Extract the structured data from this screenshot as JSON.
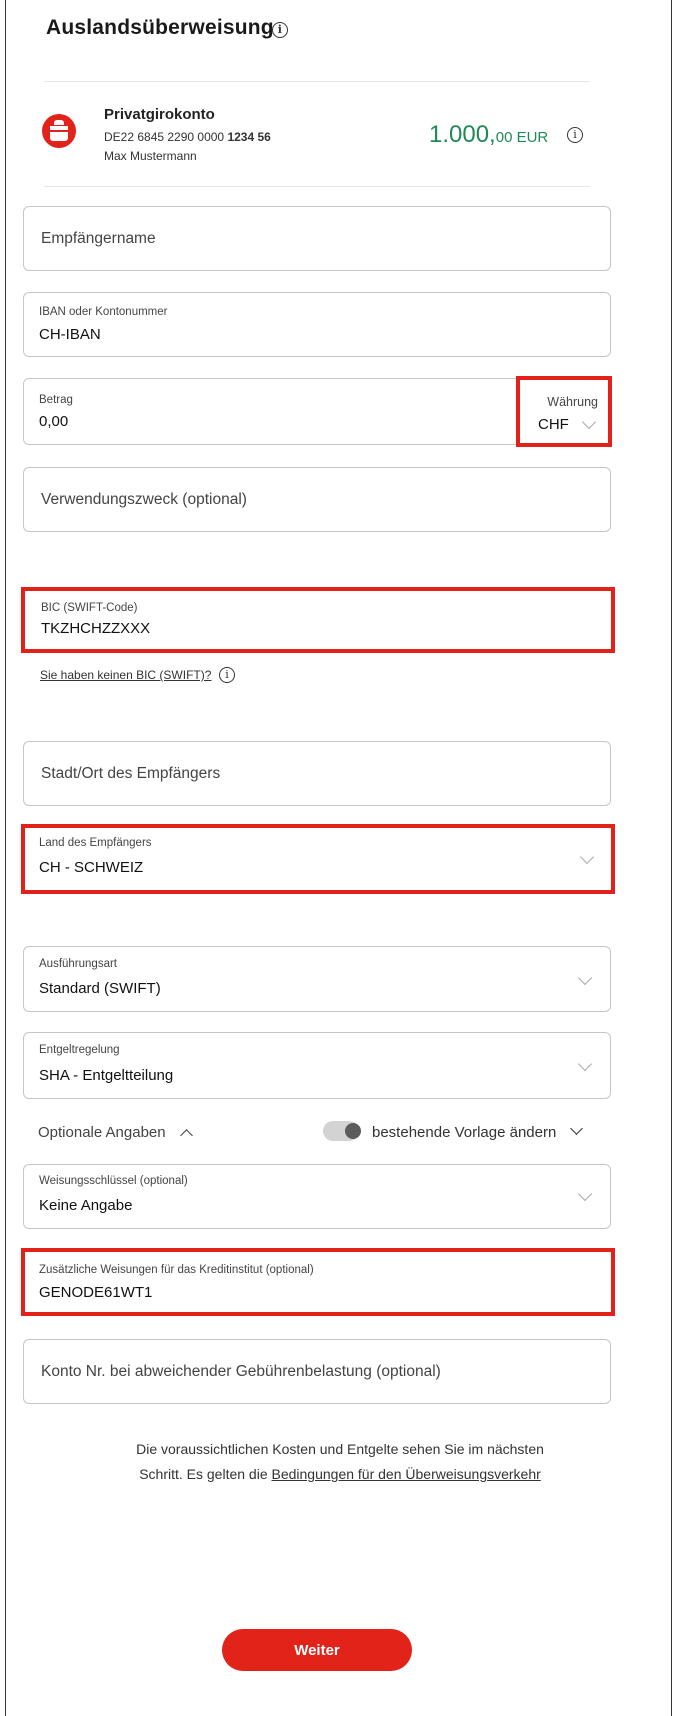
{
  "page": {
    "title": "Auslandsüberweisung",
    "title_info_icon": "info-icon"
  },
  "account": {
    "logo_icon": "sparkasse-logo",
    "name": "Privatgirokonto",
    "iban_prefix": "DE22 6845 2290 0000",
    "iban_suffix": "1234 56",
    "holder": "Max Mustermann",
    "balance_main": "1.000,",
    "balance_cents": "00 EUR",
    "balance_color": "#1f8a55"
  },
  "form": {
    "recipient_name": {
      "placeholder": "Empfängername"
    },
    "iban": {
      "label": "IBAN oder Kontonummer",
      "value": "CH-IBAN"
    },
    "amount": {
      "label": "Betrag",
      "value": "0,00"
    },
    "currency": {
      "label": "Währung",
      "value": "CHF"
    },
    "purpose": {
      "placeholder": "Verwendungszweck (optional)"
    },
    "bic": {
      "label": "BIC (SWIFT-Code)",
      "value": "TKZHCHZZXXX",
      "help_link": "Sie haben keinen BIC (SWIFT)?"
    },
    "city": {
      "placeholder": "Stadt/Ort des Empfängers"
    },
    "country": {
      "label": "Land des Empfängers",
      "value": "CH - SCHWEIZ"
    },
    "execution": {
      "label": "Ausführungsart",
      "value": "Standard (SWIFT)"
    },
    "fees": {
      "label": "Entgeltregelung",
      "value": "SHA - Entgeltteilung"
    },
    "optional_toggle": "Optionale Angaben",
    "template_toggle": "bestehende Vorlage ändern",
    "instruction_key": {
      "label": "Weisungsschlüssel (optional)",
      "value": "Keine Angabe"
    },
    "additional_instructions": {
      "label": "Zusätzliche Weisungen für das Kreditinstitut (optional)",
      "value": "GENODE61WT1"
    },
    "alt_fee_account": {
      "placeholder": "Konto Nr. bei abweichender Gebührenbelastung (optional)"
    }
  },
  "footer": {
    "note_line1": "Die voraussichtlichen Kosten und Entgelte sehen Sie im nächsten",
    "note_line2_prefix": "Schritt. Es gelten die ",
    "note_link": "Bedingungen für den Überweisungsverkehr",
    "submit_label": "Weiter"
  },
  "colors": {
    "accent": "#e2231a",
    "highlight": "#e3211b"
  }
}
